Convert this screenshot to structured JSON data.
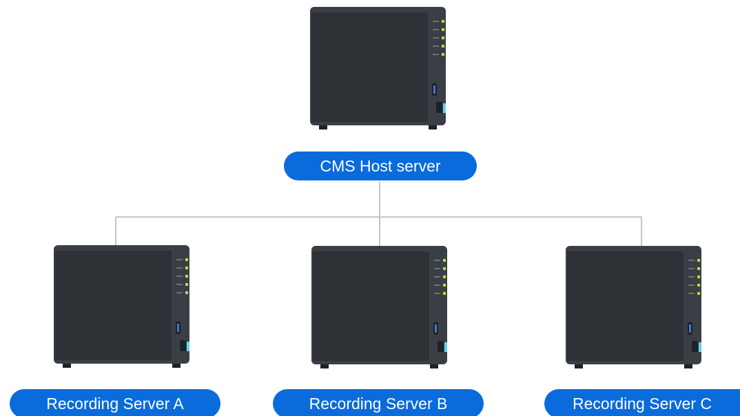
{
  "diagram": {
    "host": {
      "label": "CMS Host server",
      "icon": "nas-server-icon"
    },
    "recorders": [
      {
        "label": "Recording Server A",
        "icon": "nas-server-icon"
      },
      {
        "label": "Recording Server B",
        "icon": "nas-server-icon"
      },
      {
        "label": "Recording Server C",
        "icon": "nas-server-icon"
      }
    ]
  },
  "colors": {
    "label_pill": "#0a6bdc",
    "label_text": "#ffffff",
    "connector": "#c4c4c4",
    "server_body": "#3a3f45",
    "server_panel": "#2e3236",
    "led_green": "#b6e23a",
    "usb_blue": "#3d74d8",
    "port_cyan": "#5fd3f0"
  }
}
